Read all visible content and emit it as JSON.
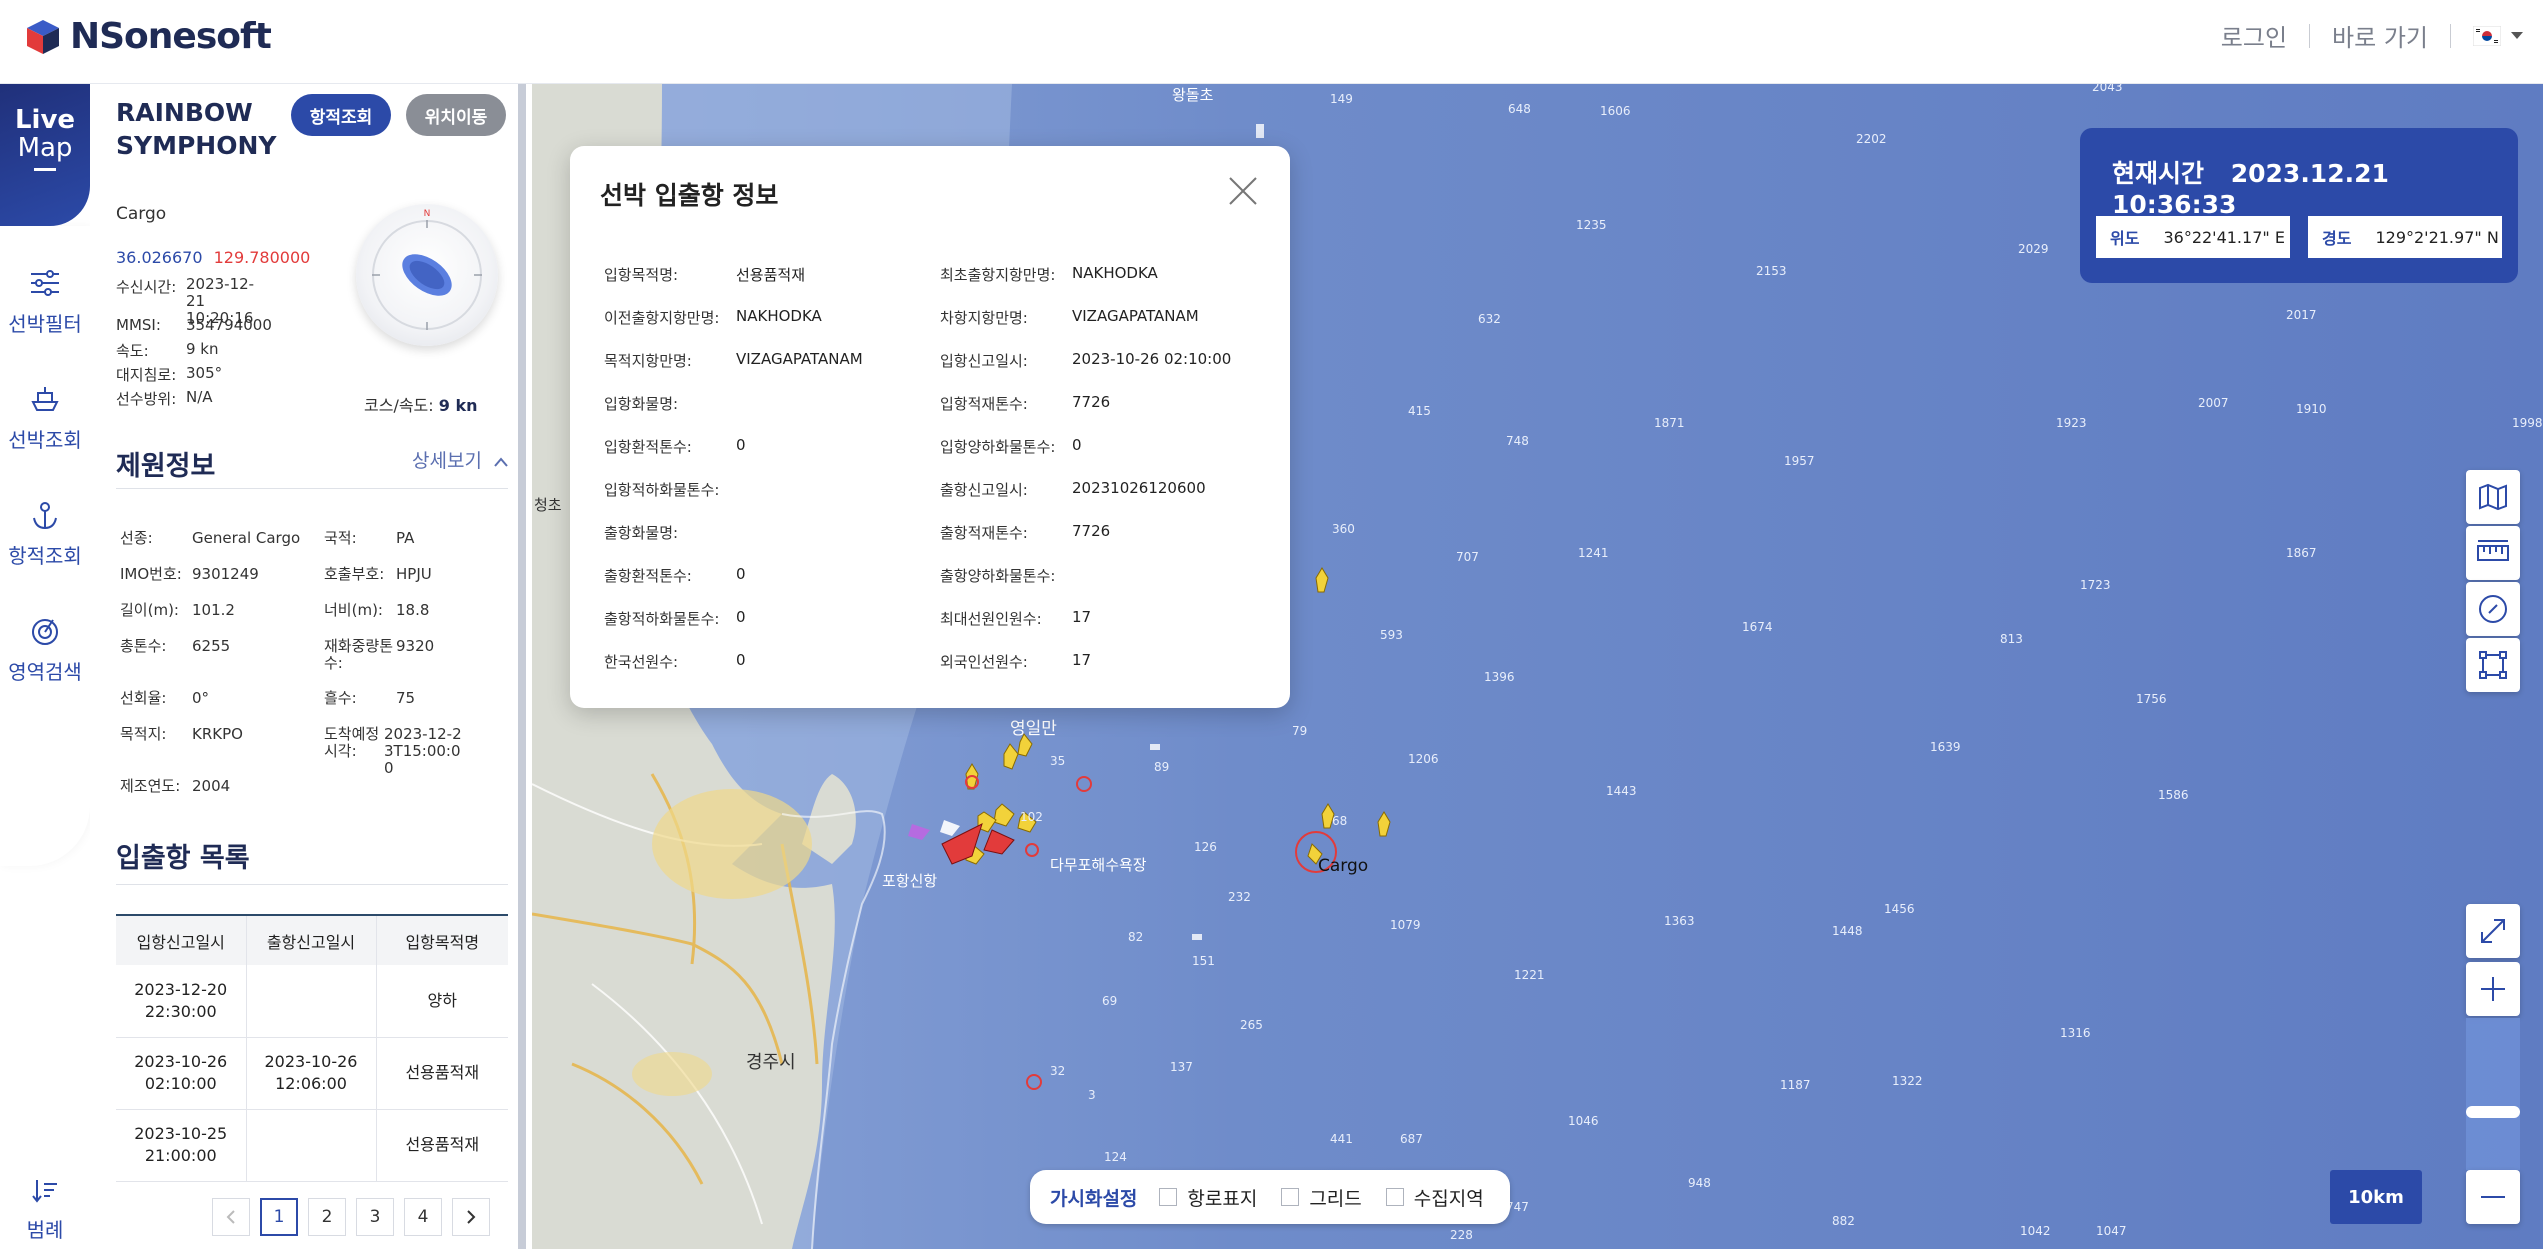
{
  "header": {
    "logo_text": "NSonesoft",
    "login": "로그인",
    "shortcut": "바로 가기"
  },
  "leftnav": {
    "live_line1": "Live",
    "live_line2": "Map",
    "items": [
      {
        "label": "선박필터",
        "icon": "sliders-icon"
      },
      {
        "label": "선박조회",
        "icon": "ship-icon"
      },
      {
        "label": "항적조회",
        "icon": "anchor-icon"
      },
      {
        "label": "영역검색",
        "icon": "radar-icon"
      }
    ],
    "legend": "범례"
  },
  "ship": {
    "name": "RAINBOW SYMPHONY",
    "btn_track": "항적조회",
    "btn_move": "위치이동",
    "type": "Cargo",
    "lat": "36.026670",
    "lon": "129.780000",
    "fields": [
      {
        "k": "수신시간:",
        "v": "2023-12-21 10:20:16"
      },
      {
        "k": "MMSI:",
        "v": "354794000"
      },
      {
        "k": "속도:",
        "v": "9 kn"
      },
      {
        "k": "대지침로:",
        "v": "305°"
      },
      {
        "k": "선수방위:",
        "v": "N/A"
      }
    ],
    "course_label": "코스/속도:",
    "course_value": "9 kn"
  },
  "specs": {
    "title": "제원정보",
    "detail": "상세보기",
    "rows": [
      {
        "k1": "선종:",
        "v1": "General Cargo",
        "k2": "국적:",
        "v2": "PA"
      },
      {
        "k1": "IMO번호:",
        "v1": "9301249",
        "k2": "호출부호:",
        "v2": "HPJU"
      },
      {
        "k1": "길이(m):",
        "v1": "101.2",
        "k2": "너비(m):",
        "v2": "18.8"
      },
      {
        "k1": "총톤수:",
        "v1": "6255",
        "k2": "재화중량톤수:",
        "v2": "9320"
      },
      {
        "k1": "선회율:",
        "v1": "0°",
        "k2": "흘수:",
        "v2": "75"
      },
      {
        "k1": "목적지:",
        "v1": "KRKPO",
        "k2": "도착예정시각:",
        "v2": "2023-12-23T15:00:00"
      },
      {
        "k1": "제조연도:",
        "v1": "2004",
        "k2": "",
        "v2": ""
      }
    ]
  },
  "portlog": {
    "title": "입출항 목록",
    "headers": [
      "입항신고일시",
      "출항신고일시",
      "입항목적명"
    ],
    "rows": [
      [
        "2023-12-20 22:30:00",
        "",
        "양하"
      ],
      [
        "2023-10-26 02:10:00",
        "2023-10-26 12:06:00",
        "선용품적재"
      ],
      [
        "2023-10-25 21:00:00",
        "",
        "선용품적재"
      ]
    ],
    "pages": [
      "1",
      "2",
      "3",
      "4"
    ],
    "current_page": "1"
  },
  "modal": {
    "title": "선박 입출항 정보",
    "left": [
      {
        "k": "입항목적명:",
        "v": "선용품적재"
      },
      {
        "k": "이전출항지항만명:",
        "v": "NAKHODKA"
      },
      {
        "k": "목적지항만명:",
        "v": "VIZAGAPATANAM"
      },
      {
        "k": "입항화물명:",
        "v": ""
      },
      {
        "k": "입항환적톤수:",
        "v": "0"
      },
      {
        "k": "입항적하화물톤수:",
        "v": ""
      },
      {
        "k": "출항화물명:",
        "v": ""
      },
      {
        "k": "출항환적톤수:",
        "v": "0"
      },
      {
        "k": "출항적하화물톤수:",
        "v": "0"
      },
      {
        "k": "한국선원수:",
        "v": "0"
      }
    ],
    "right": [
      {
        "k": "최초출항지항만명:",
        "v": "NAKHODKA"
      },
      {
        "k": "차항지항만명:",
        "v": "VIZAGAPATANAM"
      },
      {
        "k": "입항신고일시:",
        "v": "2023-10-26 02:10:00"
      },
      {
        "k": "입항적재톤수:",
        "v": "7726"
      },
      {
        "k": "입항양하화물톤수:",
        "v": "0"
      },
      {
        "k": "출항신고일시:",
        "v": "20231026120600"
      },
      {
        "k": "출항적재톤수:",
        "v": "7726"
      },
      {
        "k": "출항양하화물톤수:",
        "v": ""
      },
      {
        "k": "최대선원인원수:",
        "v": "17"
      },
      {
        "k": "외국인선원수:",
        "v": "17"
      }
    ]
  },
  "timebox": {
    "label": "현재시간",
    "value": "2023.12.21 10:36:33",
    "lat_label": "위도",
    "lat_value": "36°22'41.17\" E",
    "lon_label": "경도",
    "lon_value": "129°2'21.97\" N"
  },
  "visbar": {
    "title": "가시화설정",
    "options": [
      "항로표지",
      "그리드",
      "수집지역"
    ]
  },
  "scale": "10km",
  "map": {
    "place_labels": [
      "영일만",
      "포항신항",
      "경주시",
      "다무포해수욕장",
      "Cargo",
      "왕돌초",
      "청초"
    ],
    "depths": [
      "149",
      "648",
      "1606",
      "2202",
      "2043",
      "1235",
      "632",
      "2153",
      "2029",
      "2017",
      "415",
      "748",
      "1871",
      "1957",
      "1923",
      "2007",
      "1910",
      "1998",
      "360",
      "707",
      "1241",
      "1674",
      "1723",
      "1867",
      "593",
      "1396",
      "1206",
      "1443",
      "1639",
      "1756",
      "1586",
      "68",
      "126",
      "232",
      "79",
      "1079",
      "1363",
      "1456",
      "1448",
      "82",
      "151",
      "1221",
      "265",
      "137",
      "1316",
      "1187",
      "1322",
      "1046",
      "441",
      "687",
      "124",
      "948",
      "747",
      "882",
      "1042",
      "1047",
      "228",
      "35",
      "102",
      "89",
      "69",
      "32",
      "3",
      "813"
    ]
  },
  "colors": {
    "brand": "#2c4aa8",
    "sea": "#6a86c6",
    "land": "#d9dbd3",
    "accent_red": "#e23b3b"
  }
}
